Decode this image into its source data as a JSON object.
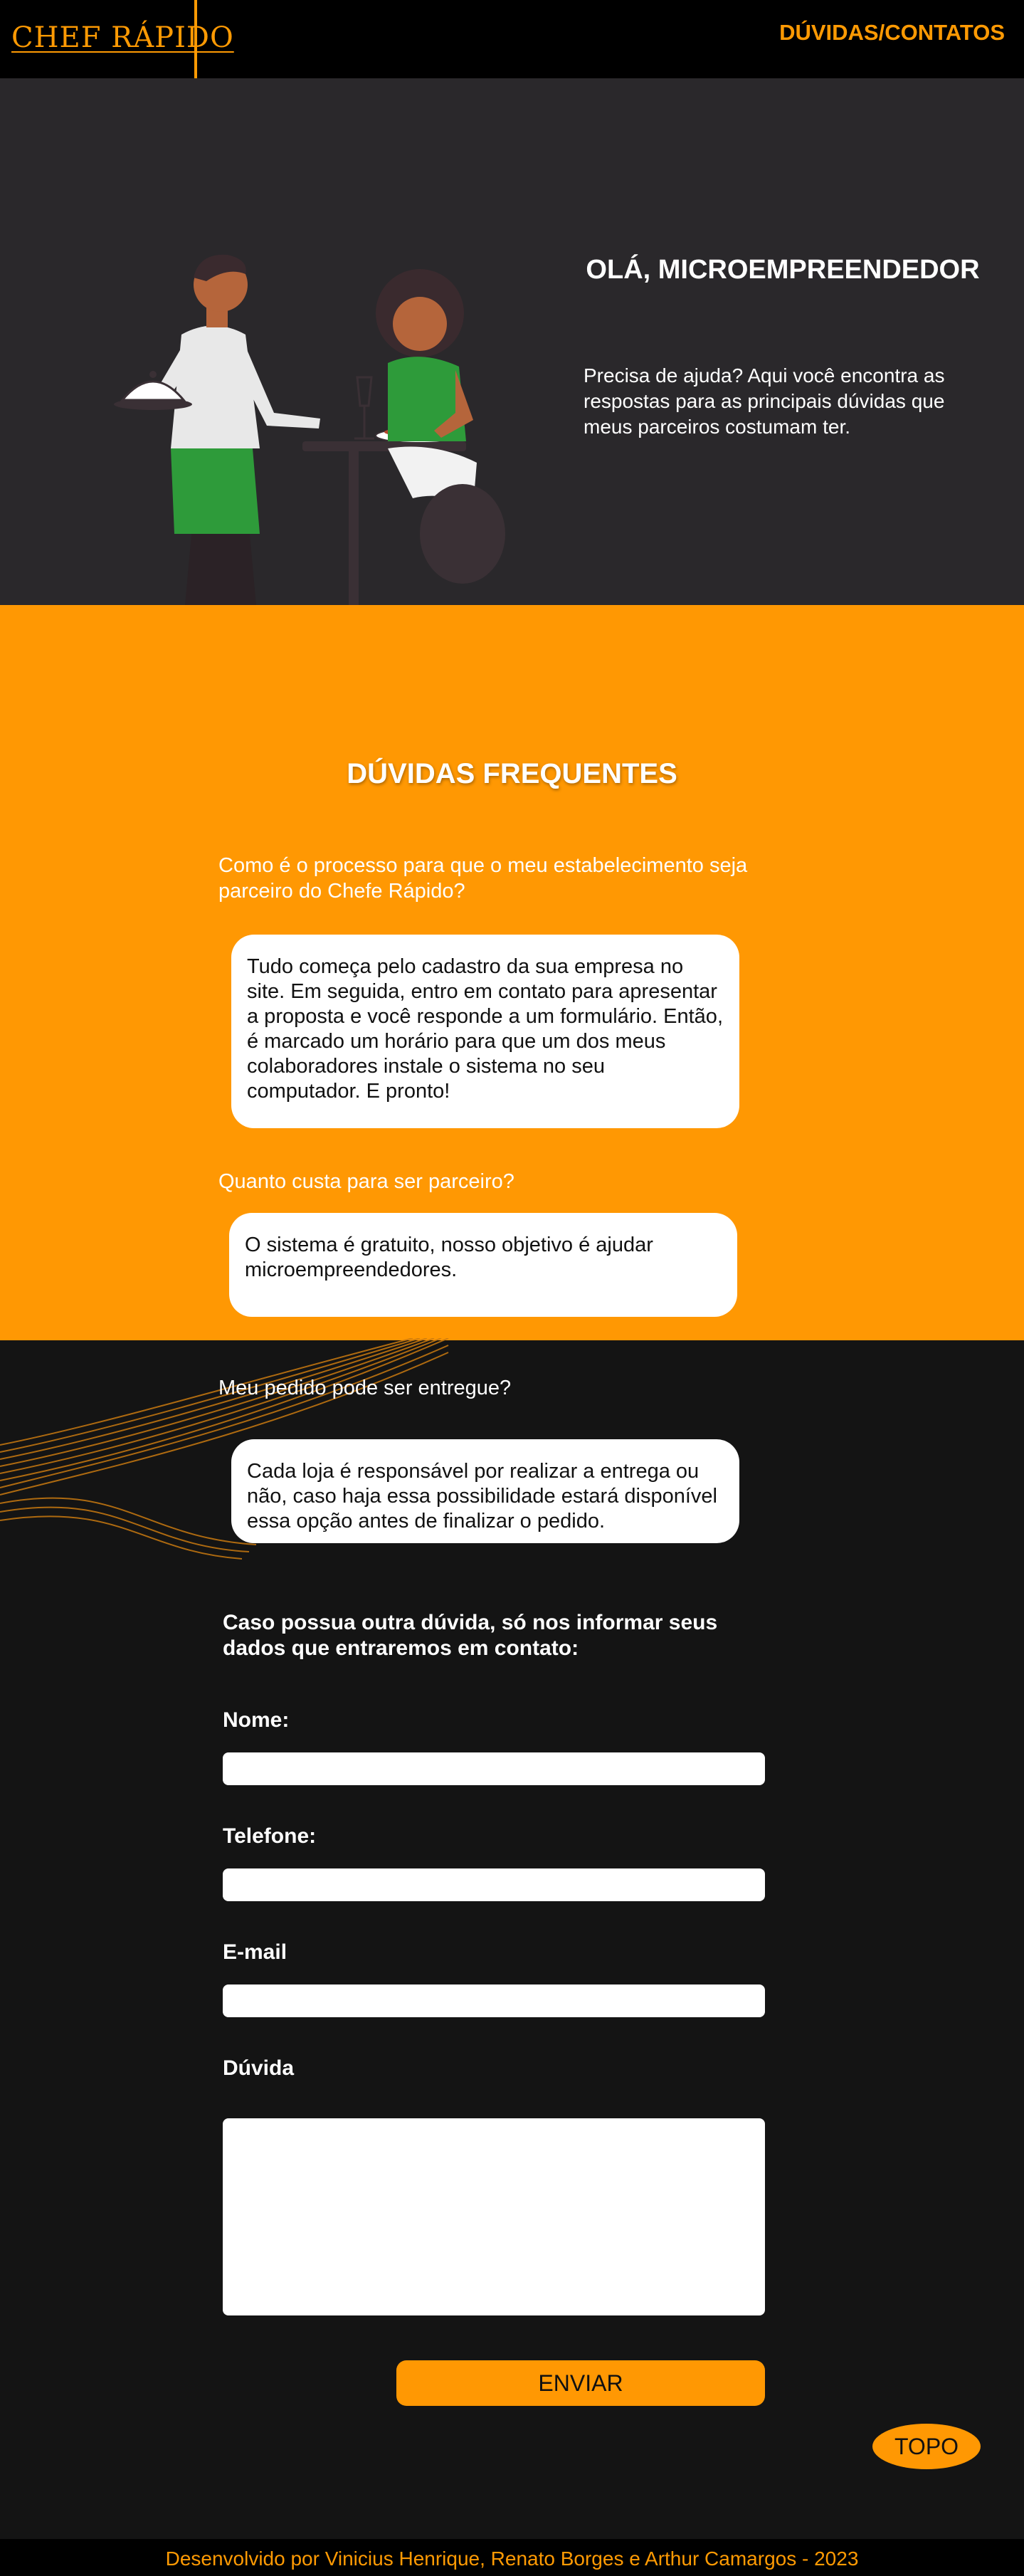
{
  "header": {
    "logo": "CHEF RÁPIDO",
    "nav_link": "DÚVIDAS/CONTATOS"
  },
  "hero": {
    "title": "OLÁ, MICROEMPREENDEDOR",
    "text": "Precisa de ajuda? Aqui você encontra as respostas para as principais dúvidas que meus parceiros costumam ter."
  },
  "faq": {
    "title": "DÚVIDAS FREQUENTES",
    "items": [
      {
        "question": "Como é o processo para que o meu estabelecimento seja parceiro do Chefe Rápido?",
        "answer": "Tudo começa pelo cadastro da sua empresa no site. Em seguida, entro em contato para apresentar a proposta e você responde a um formulário. Então, é marcado um horário para que um dos meus colaboradores instale o sistema no seu computador. E pronto!"
      },
      {
        "question": "Quanto custa para ser parceiro?",
        "answer": "O sistema é gratuito, nosso objetivo é ajudar microempreendedores."
      },
      {
        "question": "Meu pedido pode ser entregue?",
        "answer": "Cada loja é responsável por realizar a entrega ou não, caso haja essa possibilidade estará disponível essa opção antes de finalizar o pedido."
      }
    ]
  },
  "form": {
    "intro": "Caso possua outra dúvida, só nos informar seus dados que entraremos em contato:",
    "name_label": "Nome:",
    "name_value": "",
    "phone_label": "Telefone:",
    "phone_value": "",
    "email_label": "E-mail",
    "email_value": "",
    "question_label": "Dúvida",
    "question_value": "",
    "send_label": "ENVIAR"
  },
  "top_button": "TOPO",
  "footer": {
    "text": "Desenvolvido por Vinicius Henrique, Renato Borges e Arthur Camargos - 2023"
  },
  "colors": {
    "accent": "#ff9803",
    "header_bg": "#000000",
    "hero_bg": "#2a282b",
    "page_bg": "#141414"
  }
}
